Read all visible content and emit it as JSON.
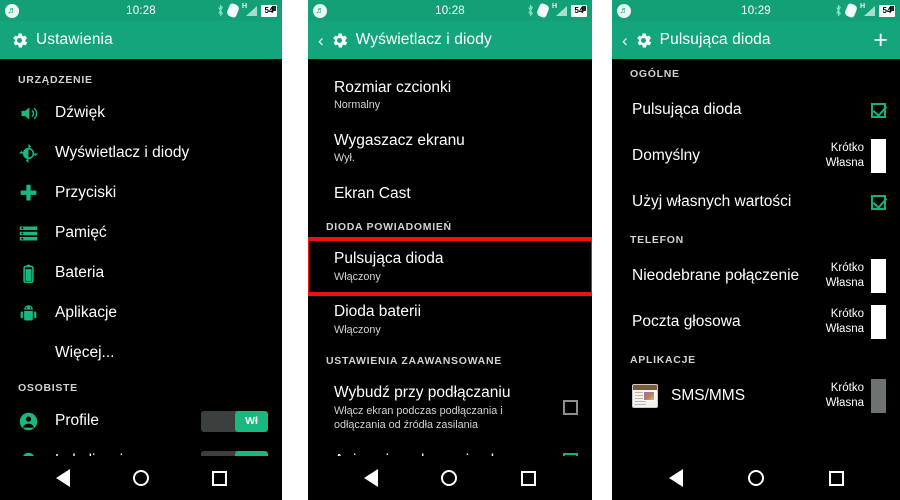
{
  "meta": {
    "accent_green": "#15a57c",
    "toggle_green": "#19b87f",
    "highlight_red": "#ee1111",
    "background": "#000000"
  },
  "panel1": {
    "status": {
      "app_icon": "spotify-icon",
      "clock": "10:28",
      "bluetooth": "bluetooth-icon",
      "nfc": "nfc-icon",
      "signal_type": "H",
      "battery_level": "54"
    },
    "appbar": {
      "title": "Ustawienia",
      "icon": "gear-icon"
    },
    "sections": [
      {
        "header": "URZĄDZENIE",
        "items": [
          {
            "label": "Dźwięk",
            "icon": "speaker-icon"
          },
          {
            "label": "Wyświetlacz i diody",
            "icon": "brightness-icon"
          },
          {
            "label": "Przyciski",
            "icon": "dpad-icon"
          },
          {
            "label": "Pamięć",
            "icon": "storage-list-icon"
          },
          {
            "label": "Bateria",
            "icon": "battery-icon"
          },
          {
            "label": "Aplikacje",
            "icon": "android-icon"
          },
          {
            "label": "Więcej...",
            "icon": "none"
          }
        ]
      },
      {
        "header": "OSOBISTE",
        "items": [
          {
            "label": "Profile",
            "icon": "person-icon",
            "toggle": "Wł"
          },
          {
            "label": "Lokalizacja",
            "icon": "location-pin-icon",
            "toggle": "Wł"
          }
        ]
      }
    ]
  },
  "panel2": {
    "status": {
      "app_icon": "spotify-icon",
      "clock": "10:28",
      "bluetooth": "bluetooth-icon",
      "nfc": "nfc-icon",
      "signal_type": "H",
      "battery_level": "54"
    },
    "appbar": {
      "title": "Wyświetlacz i diody",
      "icon": "gear-icon",
      "back": "back-chevron-icon"
    },
    "items": [
      {
        "title": "Rozmiar czcionki",
        "subtitle": "Normalny"
      },
      {
        "title": "Wygaszacz ekranu",
        "subtitle": "Wył."
      },
      {
        "title": "Ekran Cast",
        "subtitle": ""
      }
    ],
    "section_led": "DIODA POWIADOMIEŃ",
    "led_items": [
      {
        "title": "Pulsująca dioda",
        "subtitle": "Włączony",
        "highlighted": true
      },
      {
        "title": "Dioda baterii",
        "subtitle": "Włączony",
        "highlighted": false
      }
    ],
    "section_advanced": "USTAWIENIA ZAAWANSOWANE",
    "advanced_items": [
      {
        "title": "Wybudź przy podłączaniu",
        "subtitle": "Włącz ekran podczas podłączania i odłączania od źródła zasilania",
        "checked": false
      },
      {
        "title": "Animacja wyłączenia ekranu",
        "subtitle": "",
        "checked": true
      }
    ]
  },
  "panel3": {
    "status": {
      "app_icon": "spotify-icon",
      "clock": "10:29",
      "bluetooth": "bluetooth-icon",
      "nfc": "nfc-icon",
      "signal_type": "H",
      "battery_level": "54"
    },
    "appbar": {
      "title": "Pulsująca dioda",
      "icon": "gear-icon",
      "back": "back-chevron-icon",
      "add": "+"
    },
    "sections": [
      {
        "header": "OGÓLNE",
        "rows": [
          {
            "label": "Pulsująca dioda",
            "type": "checkbox",
            "checked": true
          },
          {
            "label": "Domyślny",
            "type": "color",
            "line1": "Krótko",
            "line2": "Własna",
            "swatch": "white"
          },
          {
            "label": "Użyj własnych wartości",
            "type": "checkbox",
            "checked": true
          }
        ]
      },
      {
        "header": "TELEFON",
        "rows": [
          {
            "label": "Nieodebrane połączenie",
            "type": "color",
            "line1": "Krótko",
            "line2": "Własna",
            "swatch": "white"
          },
          {
            "label": "Poczta głosowa",
            "type": "color",
            "line1": "Krótko",
            "line2": "Własna",
            "swatch": "white"
          }
        ]
      },
      {
        "header": "APLIKACJE",
        "rows": [
          {
            "label": "SMS/MMS",
            "type": "app",
            "icon": "messaging-app-icon",
            "line1": "Krótko",
            "line2": "Własna",
            "swatch": "gray"
          }
        ]
      }
    ]
  },
  "navbar": {
    "back": "back-triangle-icon",
    "home": "home-circle-icon",
    "recents": "recents-square-icon"
  }
}
